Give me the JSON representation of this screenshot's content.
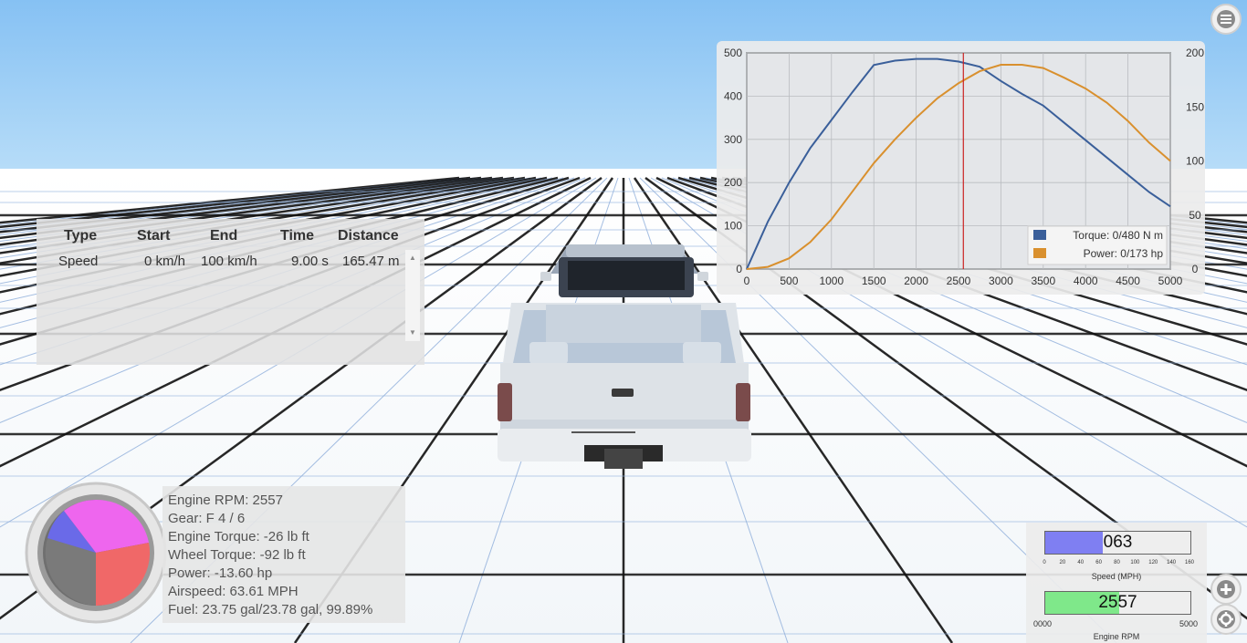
{
  "perf_table": {
    "headers": [
      "Type",
      "Start",
      "End",
      "Time",
      "Distance"
    ],
    "rows": [
      [
        "Speed",
        "0 km/h",
        "100 km/h",
        "9.00 s",
        "165.47 m"
      ]
    ]
  },
  "engine_info": {
    "lines": [
      "Engine RPM: 2557",
      "Gear: F 4 / 6",
      "Engine Torque: -26 lb ft",
      "Wheel Torque: -92 lb ft",
      "Power: -13.60 hp",
      "Airspeed: 63.61 MPH",
      "Fuel: 23.75 gal/23.78 gal, 99.89%"
    ]
  },
  "chart_data": {
    "type": "line",
    "x": [
      0,
      250,
      500,
      750,
      1000,
      1250,
      1500,
      1750,
      2000,
      2250,
      2500,
      2750,
      3000,
      3250,
      3500,
      3750,
      4000,
      4250,
      4500,
      4750,
      5000
    ],
    "xlim": [
      0,
      5000
    ],
    "x_ticks": [
      "0",
      "500",
      "1000",
      "1500",
      "2000",
      "2500",
      "3000",
      "3500",
      "4000",
      "4500",
      "5000"
    ],
    "y_left_ticks": [
      "0",
      "100",
      "200",
      "300",
      "400",
      "500"
    ],
    "y_left_lim": [
      0,
      500
    ],
    "y_right_ticks": [
      "0",
      "50",
      "100",
      "150",
      "200"
    ],
    "y_right_lim": [
      0,
      200
    ],
    "series": [
      {
        "name": "Torque: 0/480 N m",
        "axis": "left",
        "color": "#3a5f9a",
        "values": [
          0,
          110,
          200,
          280,
          345,
          410,
          472,
          482,
          486,
          486,
          480,
          468,
          435,
          405,
          378,
          338,
          298,
          258,
          218,
          178,
          145
        ]
      },
      {
        "name": "Power: 0/173 hp",
        "axis": "right",
        "color": "#d9902e",
        "values": [
          0,
          2,
          10,
          25,
          46,
          72,
          98,
          120,
          140,
          158,
          172,
          183,
          189,
          189,
          186,
          177,
          167,
          154,
          137,
          117,
          100
        ]
      }
    ],
    "marker_x": 2557,
    "marker_color": "#cc2222",
    "grid": true,
    "legend": "bottom-right"
  },
  "speed_gauge": {
    "value_text": "063",
    "label": "Speed (MPH)",
    "ticks": [
      "0",
      "20",
      "40",
      "60",
      "80",
      "100",
      "120",
      "140",
      "160"
    ],
    "max": 160,
    "value": 63,
    "color": "#7f7ff2"
  },
  "rpm_gauge": {
    "value_text": "2557",
    "label": "Engine RPM",
    "min_label": "0000",
    "max_label": "5000",
    "max": 5000,
    "value": 2557,
    "color": "#7fe88a"
  },
  "icons": {
    "menu": "menu-icon",
    "zoom": "plus-icon",
    "settings": "gear-icon"
  },
  "colors": {
    "sky_top": "#8ec6f4",
    "grid_line": "#000000",
    "pie_pink": "#ee66ee",
    "pie_red": "#f06868",
    "pie_blue": "#6a6ae8"
  }
}
